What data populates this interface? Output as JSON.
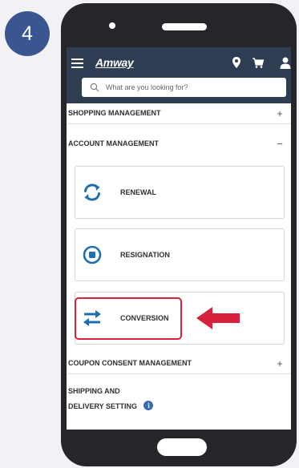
{
  "step": {
    "number": "4"
  },
  "header": {
    "brand": "Amway",
    "icons": [
      "menu-icon",
      "location-pin-icon",
      "cart-icon",
      "user-icon"
    ]
  },
  "search": {
    "placeholder": "What are you looking for?"
  },
  "sections": {
    "shopping": {
      "title": "SHOPPING MANAGEMENT",
      "toggle": "+"
    },
    "account": {
      "title": "ACCOUNT MANAGEMENT",
      "toggle": "−",
      "options": [
        {
          "label": "RENEWAL",
          "icon": "refresh-icon"
        },
        {
          "label": "RESIGNATION",
          "icon": "stop-circle-icon"
        },
        {
          "label": "CONVERSION",
          "icon": "swap-arrows-icon"
        }
      ]
    },
    "coupon": {
      "title": "COUPON CONSENT MANAGEMENT",
      "toggle": "+"
    },
    "shipping": {
      "title_line1": "SHIPPING AND",
      "title_line2": "DELIVERY SETTING",
      "info": "i"
    }
  },
  "colors": {
    "badge": "#3a5691",
    "header": "#2e3d52",
    "icon_blue": "#1f6fb0",
    "highlight": "#d6203c",
    "phone": "#26262a"
  }
}
